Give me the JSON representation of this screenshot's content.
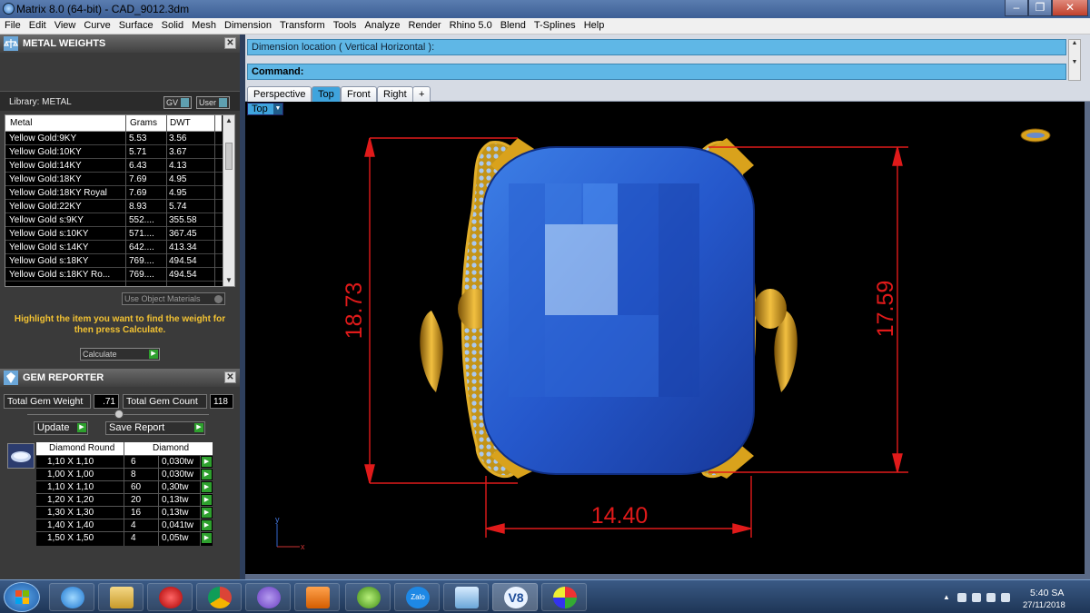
{
  "window": {
    "title": "Matrix 8.0 (64-bit) - CAD_9012.3dm",
    "min_icon": "minimize-icon",
    "max_icon": "maximize-icon",
    "close_icon": "close-icon",
    "min_glyph": "–",
    "max_glyph": "❐",
    "close_glyph": "✕"
  },
  "menu": [
    "File",
    "Edit",
    "View",
    "Curve",
    "Surface",
    "Solid",
    "Mesh",
    "Dimension",
    "Transform",
    "Tools",
    "Analyze",
    "Render",
    "Rhino 5.0",
    "Blend",
    "T-Splines",
    "Help"
  ],
  "metal_weights": {
    "title": "METAL WEIGHTS",
    "library_label": "Library: METAL",
    "toggle_gv": "GV",
    "toggle_user": "User",
    "columns": [
      "Metal",
      "Grams",
      "DWT"
    ],
    "rows": [
      [
        "Yellow Gold:9KY",
        "5.53",
        "3.56"
      ],
      [
        "Yellow Gold:10KY",
        "5.71",
        "3.67"
      ],
      [
        "Yellow Gold:14KY",
        "6.43",
        "4.13"
      ],
      [
        "Yellow Gold:18KY",
        "7.69",
        "4.95"
      ],
      [
        "Yellow Gold:18KY Royal",
        "7.69",
        "4.95"
      ],
      [
        "Yellow Gold:22KY",
        "8.93",
        "5.74"
      ],
      [
        "Yellow Gold s:9KY",
        "552....",
        "355.58"
      ],
      [
        "Yellow Gold s:10KY",
        "571....",
        "367.45"
      ],
      [
        "Yellow Gold s:14KY",
        "642....",
        "413.34"
      ],
      [
        "Yellow Gold s:18KY",
        "769....",
        "494.54"
      ],
      [
        "Yellow Gold s:18KY Ro...",
        "769....",
        "494.54"
      ]
    ],
    "use_object_materials": "Use Object Materials",
    "hint": "Highlight the item you want to find the weight for then press Calculate.",
    "calculate": "Calculate"
  },
  "gem_reporter": {
    "title": "GEM REPORTER",
    "total_weight_label": "Total Gem Weight",
    "total_weight_value": ".71",
    "total_count_label": "Total Gem Count",
    "total_count_value": "118",
    "update": "Update",
    "save_report": "Save Report",
    "columns": [
      "Diamond Round",
      "Diamond"
    ],
    "rows": [
      [
        "1,10 X 1,10",
        "6",
        "0,030tw"
      ],
      [
        "1,00 X 1,00",
        "8",
        "0,030tw"
      ],
      [
        "1,10 X 1,10",
        "60",
        "0,30tw"
      ],
      [
        "1,20 X 1,20",
        "20",
        "0,13tw"
      ],
      [
        "1,30 X 1,30",
        "16",
        "0,13tw"
      ],
      [
        "1,40 X 1,40",
        "4",
        "0,041tw"
      ],
      [
        "1,50 X 1,50",
        "4",
        "0,05tw"
      ]
    ]
  },
  "command": {
    "dimension_prompt": "Dimension location ( Vertical  Horizontal ):",
    "command_label": "Command:"
  },
  "tabs": [
    "Perspective",
    "Top",
    "Front",
    "Right",
    "+"
  ],
  "active_tab": "Top",
  "viewport": {
    "label": "Top",
    "dim_left": "18.73",
    "dim_right": "17.59",
    "dim_bottom": "14.40",
    "axis_x": "x",
    "axis_y": "y",
    "dim_color": "#e01a1a",
    "gem_color": "#2a63d8",
    "gold_color": "#d9a21c"
  },
  "taskbar": {
    "icons": [
      "ie-icon",
      "file-explorer-icon",
      "garena-icon",
      "chrome-icon",
      "viber-icon",
      "media-player-icon",
      "app-icon",
      "zalo-icon",
      "control-panel-icon",
      "v8-icon",
      "paint-icon"
    ],
    "zalo_text": "Zalo",
    "v8_text": "V8",
    "time": "5:40 SA",
    "date": "27/11/2018"
  }
}
